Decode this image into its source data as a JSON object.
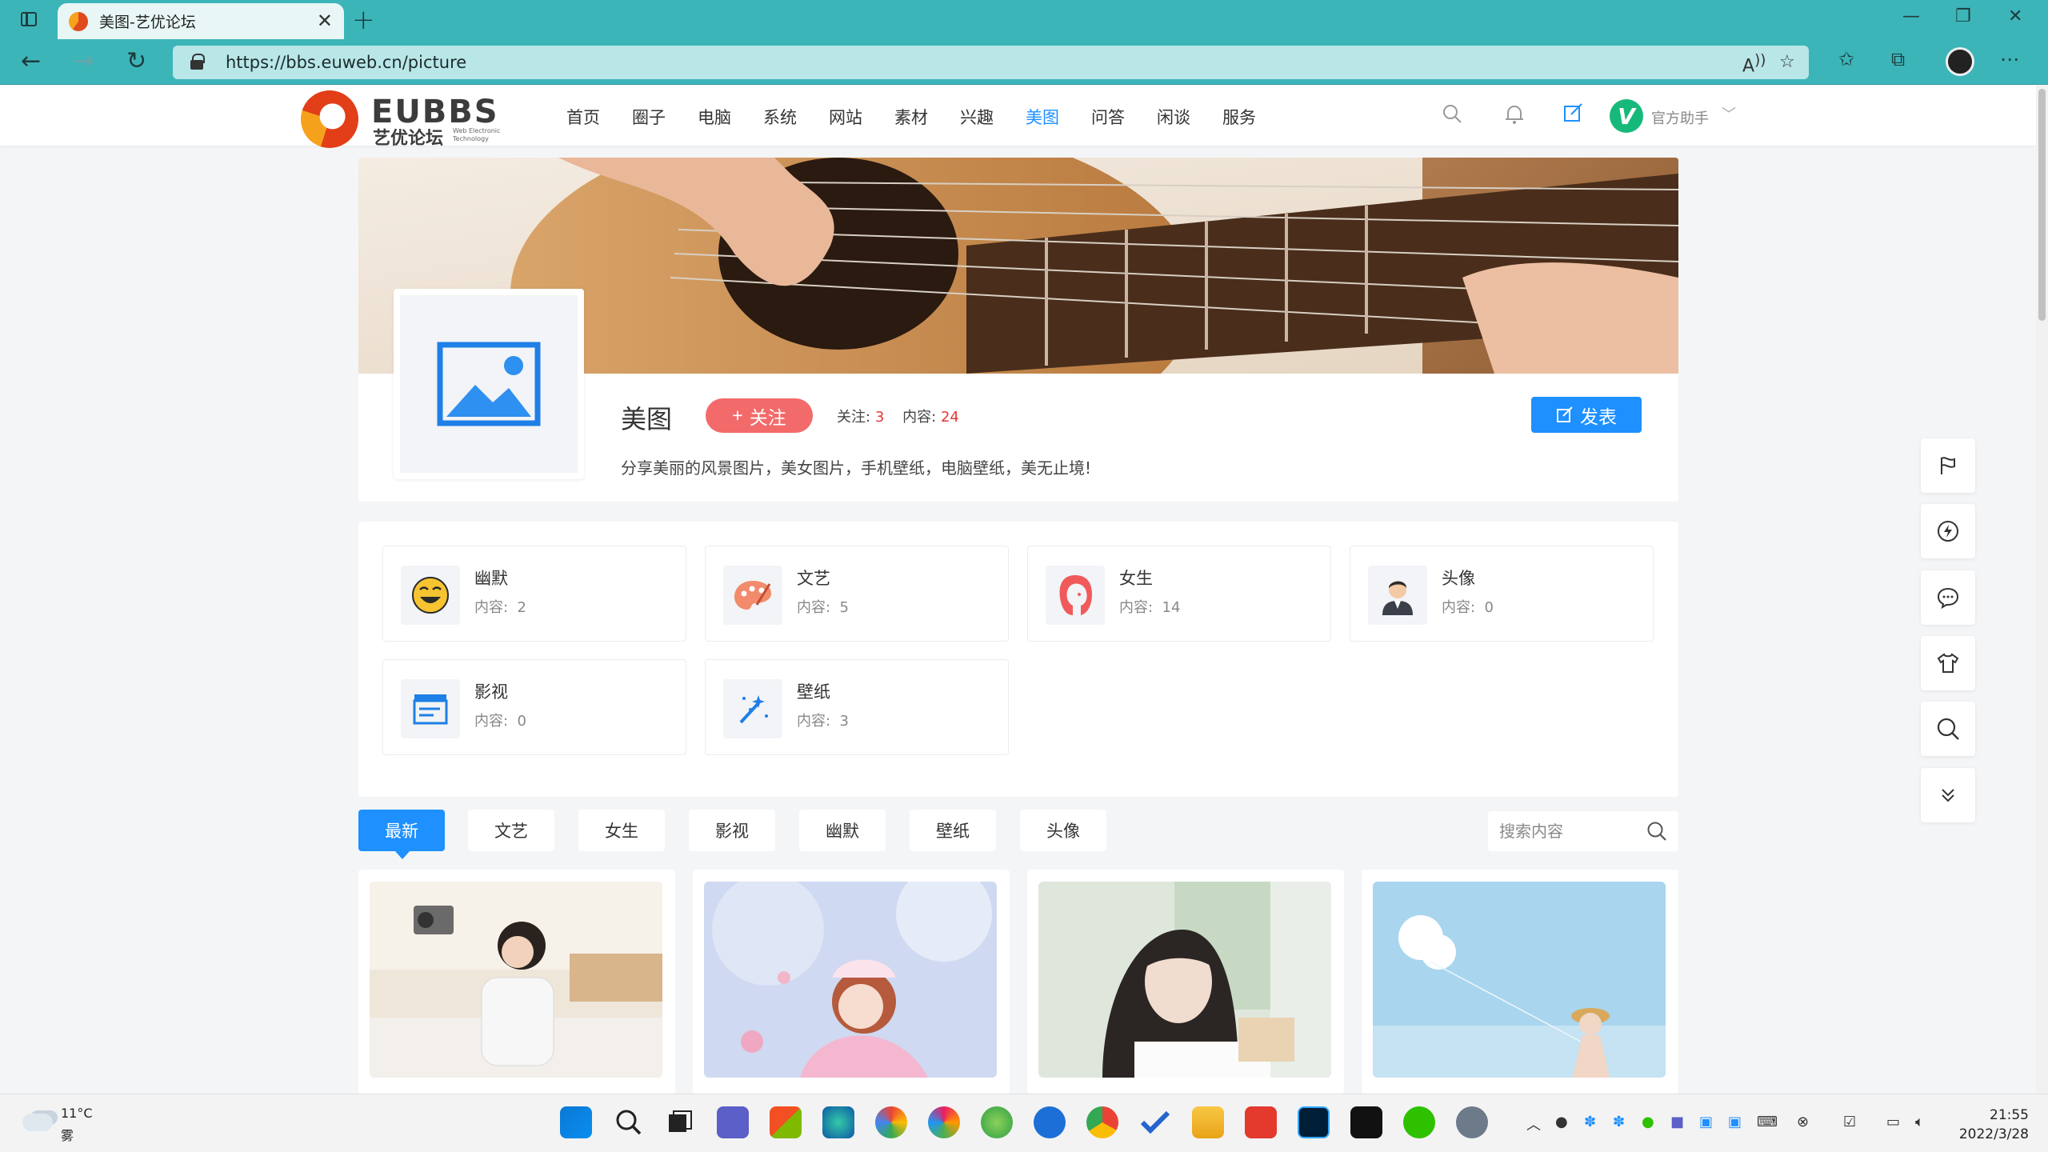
{
  "browser": {
    "tab_title": "美图-艺优论坛",
    "url": "https://bbs.euweb.cn/picture"
  },
  "site": {
    "logo_en": "EUBBS",
    "logo_cn": "艺优论坛",
    "logo_sub": "Web Electronic Technology",
    "nav": [
      "首页",
      "圈子",
      "电脑",
      "系统",
      "网站",
      "素材",
      "兴趣",
      "美图",
      "问答",
      "闲谈",
      "服务"
    ],
    "active_nav": "美图",
    "user_badge": "V",
    "user_name": "官方助手"
  },
  "board": {
    "name": "美图",
    "follow_label": "关注",
    "follow_count_label": "关注:",
    "follow_count": "3",
    "content_count_label": "内容:",
    "content_count": "24",
    "publish_label": "发表",
    "description": "分享美丽的风景图片，美女图片，手机壁纸，电脑壁纸，美无止境!"
  },
  "categories": [
    {
      "name": "幽默",
      "count_label": "内容:",
      "count": "2",
      "icon": "laughing-face-icon"
    },
    {
      "name": "文艺",
      "count_label": "内容:",
      "count": "5",
      "icon": "palette-icon"
    },
    {
      "name": "女生",
      "count_label": "内容:",
      "count": "14",
      "icon": "girl-face-icon"
    },
    {
      "name": "头像",
      "count_label": "内容:",
      "count": "0",
      "icon": "person-avatar-icon"
    },
    {
      "name": "影视",
      "count_label": "内容:",
      "count": "0",
      "icon": "clapperboard-icon"
    },
    {
      "name": "壁纸",
      "count_label": "内容:",
      "count": "3",
      "icon": "magic-wand-icon"
    }
  ],
  "filter_tabs": [
    "最新",
    "文艺",
    "女生",
    "影视",
    "幽默",
    "壁纸",
    "头像"
  ],
  "active_filter": "最新",
  "search": {
    "placeholder": "搜索内容"
  },
  "colors": {
    "accent": "#1e90ff",
    "follow": "#f36a6a",
    "count": "#e53935"
  },
  "taskbar": {
    "weather_temp": "11°C",
    "weather_desc": "雾",
    "time": "21:55",
    "date": "2022/3/28"
  }
}
